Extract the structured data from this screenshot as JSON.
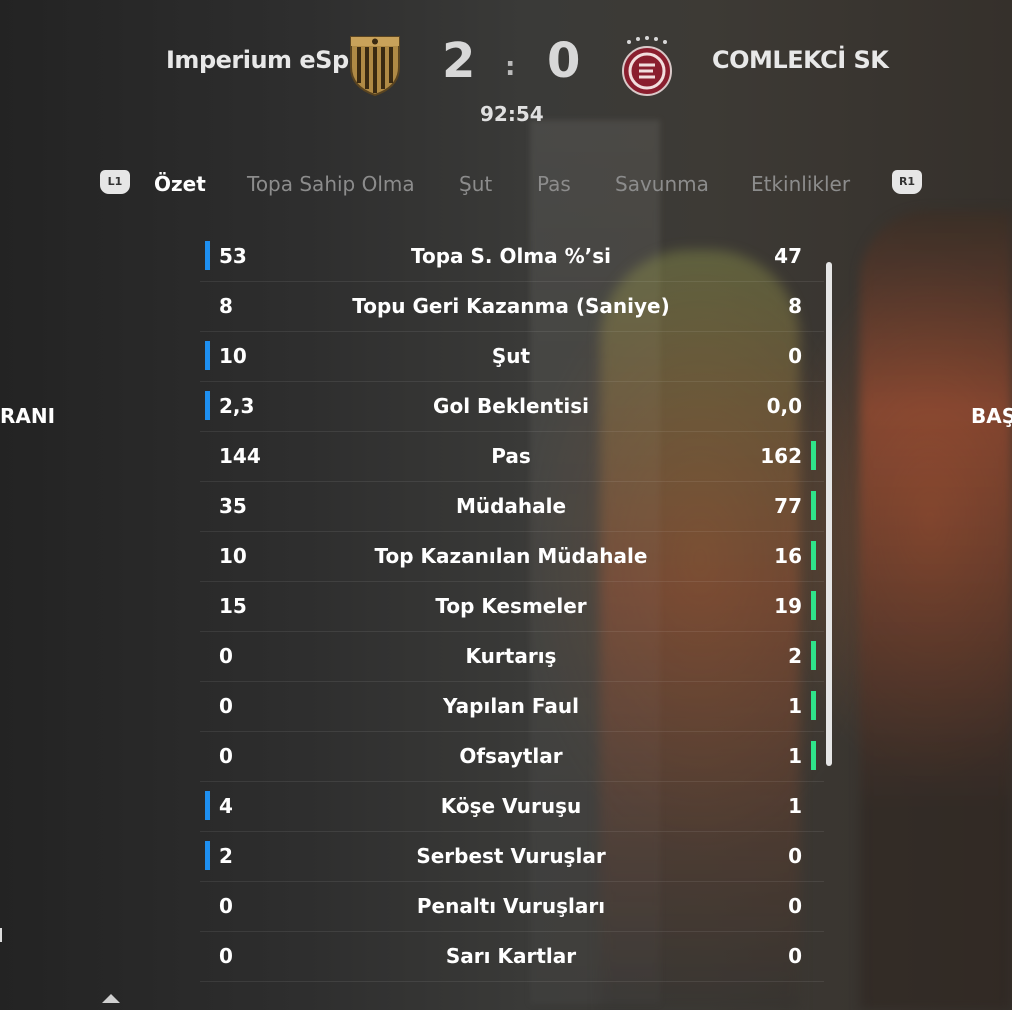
{
  "match": {
    "home_team": "Imperium eSp",
    "away_team": "COMLEKCİ SK",
    "home_score": "2",
    "separator": ":",
    "away_score": "0",
    "clock": "92:54",
    "home_crest_icon": "striped-shield-crest-icon",
    "away_crest_icon": "round-star-crest-icon"
  },
  "nav": {
    "left_button": "L1",
    "right_button": "R1",
    "tabs": [
      {
        "label": "Özet",
        "active": true
      },
      {
        "label": "Topa Sahip Olma",
        "active": false
      },
      {
        "label": "Şut",
        "active": false
      },
      {
        "label": "Pas",
        "active": false
      },
      {
        "label": "Savunma",
        "active": false
      },
      {
        "label": "Etkinlikler",
        "active": false
      }
    ]
  },
  "side": {
    "left_label": "RANI",
    "right_label": "BAŞ"
  },
  "colors": {
    "home_highlight": "#1e8ff0",
    "away_highlight": "#2fe38a",
    "active_tab": "#ffffff",
    "inactive_tab": "#8c8c8c"
  },
  "stats": [
    {
      "home": "53",
      "label": "Topa S. Olma %’si",
      "away": "47",
      "leader": "home"
    },
    {
      "home": "8",
      "label": "Topu Geri Kazanma (Saniye)",
      "away": "8",
      "leader": "none"
    },
    {
      "home": "10",
      "label": "Şut",
      "away": "0",
      "leader": "home"
    },
    {
      "home": "2,3",
      "label": "Gol Beklentisi",
      "away": "0,0",
      "leader": "home"
    },
    {
      "home": "144",
      "label": "Pas",
      "away": "162",
      "leader": "away"
    },
    {
      "home": "35",
      "label": "Müdahale",
      "away": "77",
      "leader": "away"
    },
    {
      "home": "10",
      "label": "Top Kazanılan Müdahale",
      "away": "16",
      "leader": "away"
    },
    {
      "home": "15",
      "label": "Top Kesmeler",
      "away": "19",
      "leader": "away"
    },
    {
      "home": "0",
      "label": "Kurtarış",
      "away": "2",
      "leader": "away"
    },
    {
      "home": "0",
      "label": "Yapılan Faul",
      "away": "1",
      "leader": "away"
    },
    {
      "home": "0",
      "label": "Ofsaytlar",
      "away": "1",
      "leader": "away"
    },
    {
      "home": "4",
      "label": "Köşe Vuruşu",
      "away": "1",
      "leader": "home"
    },
    {
      "home": "2",
      "label": "Serbest Vuruşlar",
      "away": "0",
      "leader": "home"
    },
    {
      "home": "0",
      "label": "Penaltı Vuruşları",
      "away": "0",
      "leader": "none"
    },
    {
      "home": "0",
      "label": "Sarı Kartlar",
      "away": "0",
      "leader": "none"
    }
  ]
}
